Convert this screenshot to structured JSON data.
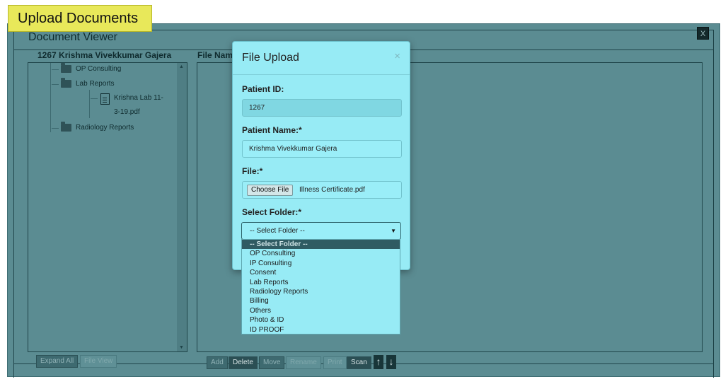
{
  "page": {
    "title": "Upload Documents"
  },
  "viewer": {
    "title": "Document Viewer",
    "close_label": "X",
    "patient_heading": "1267 Krishma Vivekkumar Gajera",
    "file_name_heading": "File Nam"
  },
  "tree": {
    "items": [
      {
        "label": "OP Consulting",
        "type": "folder"
      },
      {
        "label": "Lab Reports",
        "type": "folder-open"
      },
      {
        "label": "Krishna Lab 11-",
        "label2": "3-19.pdf",
        "type": "file"
      },
      {
        "label": "Radiology Reports",
        "type": "folder"
      }
    ]
  },
  "left_buttons": {
    "expand_all": "Expand All",
    "file_view": "File View"
  },
  "toolbar": {
    "add": "Add",
    "delete": "Delete",
    "move": "Move",
    "rename": "Rename",
    "print": "Print",
    "scan": "Scan",
    "up": "↑",
    "down": "↓"
  },
  "modal": {
    "title": "File Upload",
    "close": "×",
    "patient_id_label": "Patient ID:",
    "patient_id_value": "1267",
    "patient_name_label": "Patient Name:*",
    "patient_name_value": "Krishma Vivekkumar Gajera",
    "file_label": "File:*",
    "choose_file": "Choose File",
    "chosen_file_name": "Illness Certificate.pdf",
    "select_folder_label": "Select Folder:*",
    "select_value": "-- Select Folder --",
    "options": [
      "-- Select Folder --",
      "OP Consulting",
      "IP Consulting",
      "Consent",
      "Lab Reports",
      "Radiology Reports",
      "Billing",
      "Others",
      "Photo & ID",
      "ID PROOF"
    ]
  }
}
